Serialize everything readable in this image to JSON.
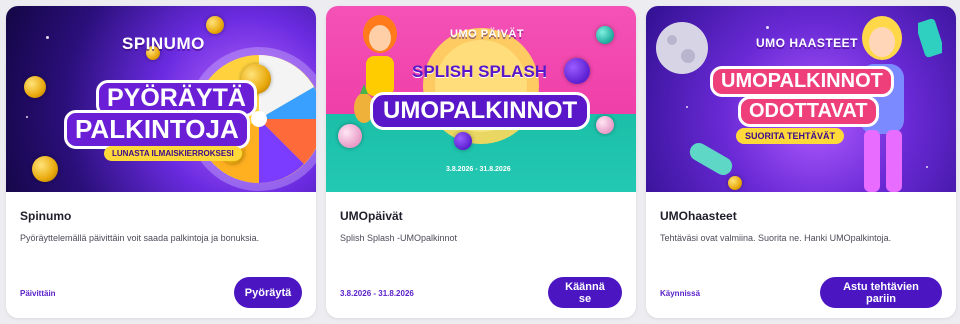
{
  "cards": [
    {
      "banner": {
        "logo": "SPINUMO",
        "headline_1": "PYÖRÄYTÄ",
        "headline_2": "PALKINTOJA",
        "tagline": "LUNASTA ILMAISKIERROKSESI"
      },
      "title": "Spinumo",
      "description": "Pyöräyttelemällä päivittäin voit saada palkintoja ja bonuksia.",
      "status": "Päivittäin",
      "button": "Pyöräytä"
    },
    {
      "banner": {
        "logo": "UMO PÄIVÄT",
        "headline_1": "SPLISH SPLASH",
        "headline_2": "UMOPALKINNOT",
        "dates": "3.8.2026 - 31.8.2026"
      },
      "title": "UMOpäivät",
      "description": "Splish Splash -UMOpalkinnot",
      "status": "3.8.2026 - 31.8.2026",
      "button": "Käännä se"
    },
    {
      "banner": {
        "logo": "UMO HAASTEET",
        "headline_1": "UMOPALKINNOT",
        "headline_2": "ODOTTAVAT",
        "tagline": "SUORITA TEHTÄVÄT"
      },
      "title": "UMOhaasteet",
      "description": "Tehtäväsi ovat valmiina. Suorita ne. Hanki UMOpalkintoja.",
      "status": "Käynnissä",
      "button": "Astu tehtävien pariin"
    }
  ]
}
